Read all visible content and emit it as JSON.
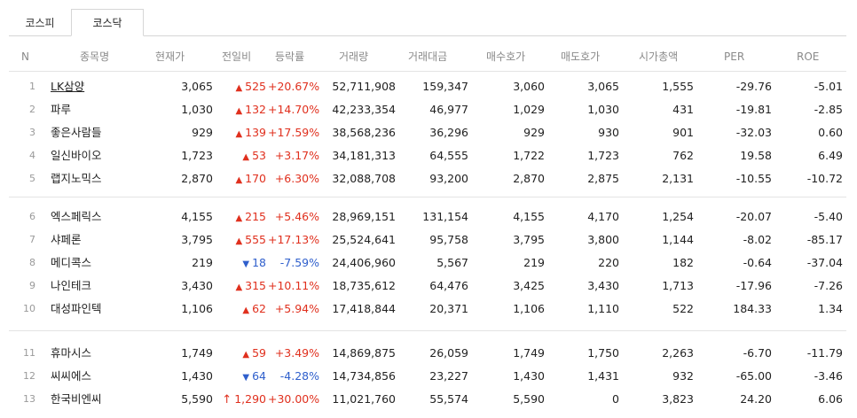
{
  "tabs": [
    {
      "label": "코스피",
      "active": false
    },
    {
      "label": "코스닥",
      "active": true
    }
  ],
  "columns": {
    "n": "N",
    "name": "종목명",
    "price": "현재가",
    "change": "전일비",
    "rate": "등락률",
    "volume": "거래량",
    "amount": "거래대금",
    "bid": "매수호가",
    "ask": "매도호가",
    "cap": "시가총액",
    "per": "PER",
    "roe": "ROE"
  },
  "rows": [
    {
      "n": "1",
      "name": "LK삼양",
      "price": "3,065",
      "dir": "up",
      "arrow": "▲",
      "change": "525",
      "rate": "+20.67%",
      "volume": "52,711,908",
      "amount": "159,347",
      "bid": "3,060",
      "ask": "3,065",
      "cap": "1,555",
      "per": "-29.76",
      "roe": "-5.01"
    },
    {
      "n": "2",
      "name": "파루",
      "price": "1,030",
      "dir": "up",
      "arrow": "▲",
      "change": "132",
      "rate": "+14.70%",
      "volume": "42,233,354",
      "amount": "46,977",
      "bid": "1,029",
      "ask": "1,030",
      "cap": "431",
      "per": "-19.81",
      "roe": "-2.85"
    },
    {
      "n": "3",
      "name": "좋은사람들",
      "price": "929",
      "dir": "up",
      "arrow": "▲",
      "change": "139",
      "rate": "+17.59%",
      "volume": "38,568,236",
      "amount": "36,296",
      "bid": "929",
      "ask": "930",
      "cap": "901",
      "per": "-32.03",
      "roe": "0.60"
    },
    {
      "n": "4",
      "name": "일신바이오",
      "price": "1,723",
      "dir": "up",
      "arrow": "▲",
      "change": "53",
      "rate": "+3.17%",
      "volume": "34,181,313",
      "amount": "64,555",
      "bid": "1,722",
      "ask": "1,723",
      "cap": "762",
      "per": "19.58",
      "roe": "6.49"
    },
    {
      "n": "5",
      "name": "랩지노믹스",
      "price": "2,870",
      "dir": "up",
      "arrow": "▲",
      "change": "170",
      "rate": "+6.30%",
      "volume": "32,088,708",
      "amount": "93,200",
      "bid": "2,870",
      "ask": "2,875",
      "cap": "2,131",
      "per": "-10.55",
      "roe": "-10.72"
    },
    {
      "n": "6",
      "name": "엑스페릭스",
      "price": "4,155",
      "dir": "up",
      "arrow": "▲",
      "change": "215",
      "rate": "+5.46%",
      "volume": "28,969,151",
      "amount": "131,154",
      "bid": "4,155",
      "ask": "4,170",
      "cap": "1,254",
      "per": "-20.07",
      "roe": "-5.40"
    },
    {
      "n": "7",
      "name": "샤페론",
      "price": "3,795",
      "dir": "up",
      "arrow": "▲",
      "change": "555",
      "rate": "+17.13%",
      "volume": "25,524,641",
      "amount": "95,758",
      "bid": "3,795",
      "ask": "3,800",
      "cap": "1,144",
      "per": "-8.02",
      "roe": "-85.17"
    },
    {
      "n": "8",
      "name": "메디콕스",
      "price": "219",
      "dir": "down",
      "arrow": "▼",
      "change": "18",
      "rate": "-7.59%",
      "volume": "24,406,960",
      "amount": "5,567",
      "bid": "219",
      "ask": "220",
      "cap": "182",
      "per": "-0.64",
      "roe": "-37.04"
    },
    {
      "n": "9",
      "name": "나인테크",
      "price": "3,430",
      "dir": "up",
      "arrow": "▲",
      "change": "315",
      "rate": "+10.11%",
      "volume": "18,735,612",
      "amount": "64,476",
      "bid": "3,425",
      "ask": "3,430",
      "cap": "1,713",
      "per": "-17.96",
      "roe": "-7.26"
    },
    {
      "n": "10",
      "name": "대성파인텍",
      "price": "1,106",
      "dir": "up",
      "arrow": "▲",
      "change": "62",
      "rate": "+5.94%",
      "volume": "17,418,844",
      "amount": "20,371",
      "bid": "1,106",
      "ask": "1,110",
      "cap": "522",
      "per": "184.33",
      "roe": "1.34"
    },
    {
      "n": "11",
      "name": "휴마시스",
      "price": "1,749",
      "dir": "up",
      "arrow": "▲",
      "change": "59",
      "rate": "+3.49%",
      "volume": "14,869,875",
      "amount": "26,059",
      "bid": "1,749",
      "ask": "1,750",
      "cap": "2,263",
      "per": "-6.70",
      "roe": "-11.79"
    },
    {
      "n": "12",
      "name": "씨씨에스",
      "price": "1,430",
      "dir": "down",
      "arrow": "▼",
      "change": "64",
      "rate": "-4.28%",
      "volume": "14,734,856",
      "amount": "23,227",
      "bid": "1,430",
      "ask": "1,431",
      "cap": "932",
      "per": "-65.00",
      "roe": "-3.46"
    },
    {
      "n": "13",
      "name": "한국비엔씨",
      "price": "5,590",
      "dir": "up",
      "arrow": "↑",
      "change": "1,290",
      "rate": "+30.00%",
      "volume": "11,021,760",
      "amount": "55,574",
      "bid": "5,590",
      "ask": "0",
      "cap": "3,823",
      "per": "24.20",
      "roe": "6.06"
    }
  ],
  "colors": {
    "up": "#e0301e",
    "down": "#2f5fcc"
  }
}
